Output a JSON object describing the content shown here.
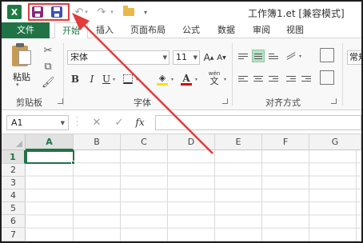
{
  "window": {
    "title": "工作簿1.et  [兼容模式]"
  },
  "qat": {
    "logo": "X",
    "undo": "↶",
    "redo": "↷",
    "more": "▾"
  },
  "tabs": [
    {
      "label": "文件"
    },
    {
      "label": "开始"
    },
    {
      "label": "插入"
    },
    {
      "label": "页面布局"
    },
    {
      "label": "公式"
    },
    {
      "label": "数据"
    },
    {
      "label": "审阅"
    },
    {
      "label": "视图"
    }
  ],
  "ribbon": {
    "clipboard": {
      "paste_label": "粘贴",
      "group_label": "剪贴板"
    },
    "font": {
      "font_name": "宋体",
      "font_size": "11",
      "grow": "A",
      "shrink": "A",
      "bold": "B",
      "italic": "I",
      "underline": "U",
      "font_color": "A",
      "phonetic": "wén",
      "phonetic_char": "文",
      "group_label": "字体",
      "fill_color": "#ffe000",
      "font_color_hex": "#e00000"
    },
    "alignment": {
      "group_label": "对齐方式"
    },
    "number": {
      "format": "常规"
    }
  },
  "formula_bar": {
    "name_box": "A1",
    "cancel": "✕",
    "enter": "✓",
    "fx": "fx"
  },
  "grid": {
    "columns": [
      "A",
      "B",
      "C",
      "D",
      "E",
      "F",
      "G"
    ],
    "rows": [
      "1",
      "2",
      "3",
      "4",
      "5",
      "6",
      "7"
    ],
    "active_cell": "A1"
  },
  "annotation": {
    "color": "#e23c3c"
  }
}
